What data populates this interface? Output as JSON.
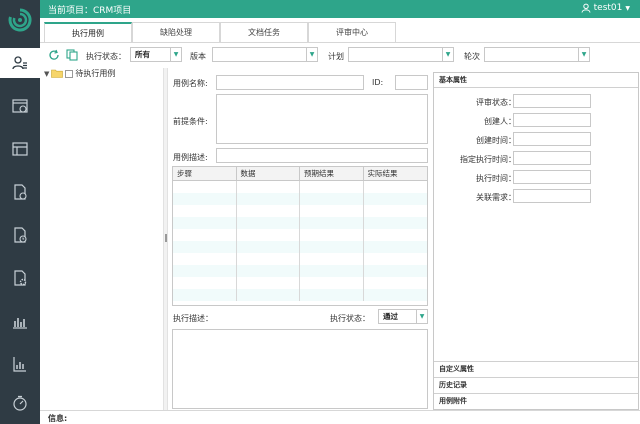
{
  "header": {
    "title": "当前项目：CRM项目",
    "username": "test01"
  },
  "tabs": [
    {
      "label": "执行用例",
      "active": true
    },
    {
      "label": "缺陷处理",
      "active": false
    },
    {
      "label": "文档任务",
      "active": false
    },
    {
      "label": "评审中心",
      "active": false
    }
  ],
  "toolbar": {
    "status_label": "执行状态：",
    "status_value": "所有",
    "version_label": "版本",
    "version_value": "",
    "plan_label": "计划",
    "plan_value": "",
    "round_label": "轮次",
    "round_value": ""
  },
  "tree": {
    "root_label": "待执行用例"
  },
  "form": {
    "case_name_label": "用例名称:",
    "id_label": "ID:",
    "precondition_label": "前提条件:",
    "description_label": "用例描述:",
    "exec_desc_label": "执行描述：",
    "exec_status_label": "执行状态：",
    "exec_status_value": "通过"
  },
  "steps_table": {
    "columns": [
      "步骤",
      "数据",
      "预期结果",
      "实际结果"
    ],
    "rows": 11
  },
  "properties": {
    "basic_section": "基本属性",
    "fields": [
      "评审状态：",
      "创建人：",
      "创建时间：",
      "指定执行时间：",
      "执行时间：",
      "关联需求："
    ],
    "custom_section": "自定义属性",
    "history_section": "历史记录",
    "attachment_section": "用例附件"
  },
  "footer": {
    "info_label": "信息:"
  },
  "colors": {
    "accent": "#2ea58a",
    "sidebar": "#2f3b44"
  },
  "icons": [
    "logo-icon",
    "user-group-icon",
    "calendar-icon",
    "board-icon",
    "doc-check-icon",
    "doc-clock-icon",
    "doc-gear-icon",
    "bar-chart-icon",
    "report-icon",
    "timer-icon",
    "refresh-icon",
    "copy-icon",
    "user-icon",
    "folder-icon"
  ]
}
